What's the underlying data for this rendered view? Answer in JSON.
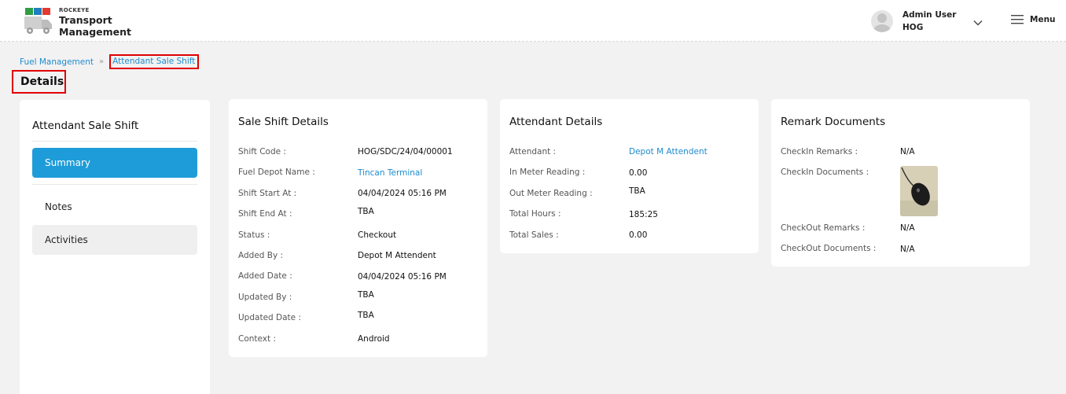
{
  "app": {
    "brand_small": "ROCKEYE",
    "brand_line1": "Transport",
    "brand_line2": "Management"
  },
  "user": {
    "name": "Admin User",
    "org": "HOG"
  },
  "menu_label": "Menu",
  "breadcrumb": {
    "parent": "Fuel Management",
    "separator": "»",
    "current": "Attendant Sale Shift"
  },
  "page_title": "Details",
  "sidebar": {
    "title": "Attendant Sale Shift",
    "items": [
      {
        "label": "Summary"
      },
      {
        "label": "Notes"
      },
      {
        "label": "Activities"
      }
    ]
  },
  "sale_shift": {
    "title": "Sale Shift Details",
    "fields": [
      {
        "label": "Shift Code :",
        "value": "HOG/SDC/24/04/00001"
      },
      {
        "label": "Fuel Depot Name :",
        "value": "Tincan Terminal"
      },
      {
        "label": "Shift Start At :",
        "value": "04/04/2024 05:16 PM"
      },
      {
        "label": "Shift End At :",
        "value": "TBA"
      },
      {
        "label": "Status :",
        "value": "Checkout"
      },
      {
        "label": "Added By :",
        "value": "Depot M Attendent"
      },
      {
        "label": "Added Date :",
        "value": "04/04/2024 05:16 PM"
      },
      {
        "label": "Updated By :",
        "value": "TBA"
      },
      {
        "label": "Updated Date :",
        "value": "TBA"
      },
      {
        "label": "Context :",
        "value": "Android"
      }
    ]
  },
  "attendant": {
    "title": "Attendant Details",
    "fields": [
      {
        "label": "Attendant :",
        "value": "Depot M Attendent"
      },
      {
        "label": "In Meter Reading :",
        "value": "0.00"
      },
      {
        "label": "Out Meter Reading :",
        "value": "TBA"
      },
      {
        "label": "Total Hours :",
        "value": "185:25"
      },
      {
        "label": "Total Sales :",
        "value": "0.00"
      }
    ]
  },
  "remarks": {
    "title": "Remark Documents",
    "fields": [
      {
        "label": "CheckIn Remarks :",
        "value": "N/A"
      },
      {
        "label": "CheckIn Documents :"
      },
      {
        "label": "CheckOut Remarks :",
        "value": "N/A"
      },
      {
        "label": "CheckOut Documents :",
        "value": "N/A"
      }
    ]
  },
  "colors": {
    "accent": "#1e9cd9",
    "link": "#1e8bcd",
    "highlight_border": "#e00000",
    "background": "#f2f2f2"
  }
}
